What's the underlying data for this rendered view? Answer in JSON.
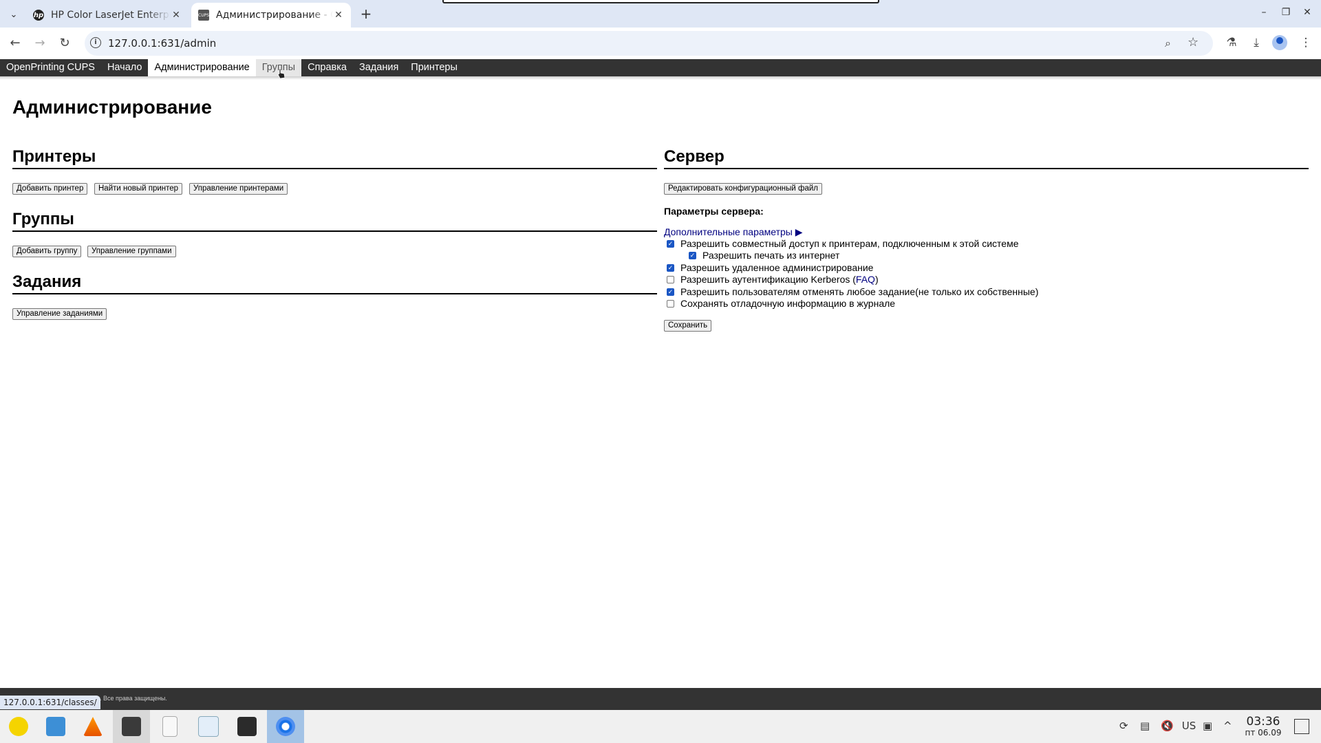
{
  "browser": {
    "tabs": [
      {
        "title": "HP Color LaserJet Enterprise",
        "active": false
      },
      {
        "title": "Администрирование - CUPS",
        "active": true
      }
    ],
    "url": "127.0.0.1:631/admin",
    "status_url": "127.0.0.1:631/classes/"
  },
  "cups_nav": {
    "items": [
      "OpenPrinting CUPS",
      "Начало",
      "Администрирование",
      "Группы",
      "Справка",
      "Задания",
      "Принтеры"
    ]
  },
  "page": {
    "title": "Администрирование",
    "printers": {
      "heading": "Принтеры",
      "buttons": [
        "Добавить принтер",
        "Найти новый принтер",
        "Управление принтерами"
      ]
    },
    "groups": {
      "heading": "Группы",
      "buttons": [
        "Добавить группу",
        "Управление группами"
      ]
    },
    "jobs": {
      "heading": "Задания",
      "buttons": [
        "Управление заданиями"
      ]
    },
    "server": {
      "heading": "Сервер",
      "edit_config_button": "Редактировать конфигурационный файл",
      "params_label": "Параметры сервера:",
      "advanced_link": "Дополнительные параметры ▶",
      "options": [
        {
          "label": "Разрешить совместный доступ к принтерам, подключенным к этой системе",
          "checked": true
        },
        {
          "label": "Разрешить печать из интернет",
          "checked": true
        },
        {
          "label": "Разрешить удаленное администрирование",
          "checked": true
        },
        {
          "label": "Разрешить аутентификацию Kerberos (",
          "faq": "FAQ",
          "suffix": ")",
          "checked": false
        },
        {
          "label": "Разрешить пользователям отменять любое задание(не только их собственные)",
          "checked": true
        },
        {
          "label": "Сохранять отладочную информацию в журнале",
          "checked": false
        }
      ],
      "save_button": "Сохранить"
    },
    "footer_copyright": "ig. Все права защищены."
  },
  "taskbar": {
    "keyboard_layout": "US",
    "time": "03:36",
    "date": "пт 06.09"
  }
}
